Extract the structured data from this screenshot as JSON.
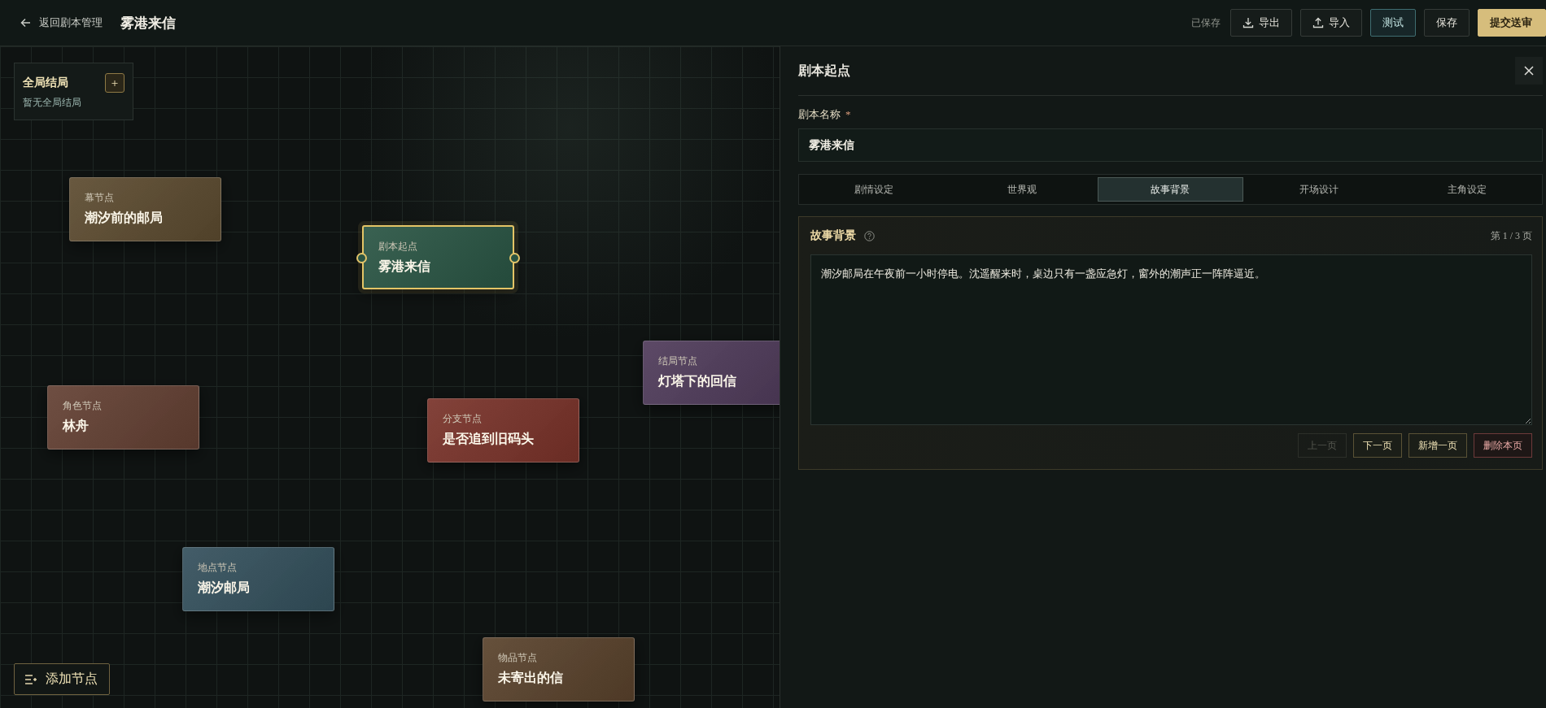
{
  "header": {
    "back_label": "返回剧本管理",
    "title": "雾港来信",
    "save_status": "已保存",
    "buttons": [
      {
        "label": "导出",
        "kind": "export"
      },
      {
        "label": "导入",
        "kind": "import"
      },
      {
        "label": "测试",
        "kind": "accent"
      },
      {
        "label": "保存",
        "kind": "default"
      },
      {
        "label": "提交送审",
        "kind": "primary"
      }
    ]
  },
  "canvas": {
    "global_endings": {
      "title": "全局结局",
      "add_label": "+",
      "empty_text": "暂无全局结局"
    },
    "nodes": [
      {
        "type_label": "幕节点",
        "name": "潮汐前的邮局",
        "color": "#5a4a30",
        "selected": false
      },
      {
        "type_label": "剧本起点",
        "name": "雾港来信",
        "color": "#2a5443",
        "selected": true
      },
      {
        "type_label": "结局节点",
        "name": "灯塔下的回信",
        "color": "#4d3a58",
        "selected": false
      },
      {
        "type_label": "角色节点",
        "name": "林舟",
        "color": "#613f33",
        "selected": false
      },
      {
        "type_label": "分支节点",
        "name": "是否追到旧码头",
        "color": "#76332a",
        "selected": false
      },
      {
        "type_label": "地点节点",
        "name": "潮汐邮局",
        "color": "#344f5a",
        "selected": false
      },
      {
        "type_label": "物品节点",
        "name": "未寄出的信",
        "color": "#57412c",
        "selected": false
      }
    ],
    "add_node_label": "添加节点"
  },
  "panel": {
    "title": "剧本起点",
    "field_label": "剧本名称",
    "required_mark": "*",
    "field_value": "雾港来信",
    "tabs": [
      {
        "label": "剧情设定",
        "selected": false
      },
      {
        "label": "世界观",
        "selected": false
      },
      {
        "label": "故事背景",
        "selected": true
      },
      {
        "label": "开场设计",
        "selected": false
      },
      {
        "label": "主角设定",
        "selected": false
      }
    ],
    "section": {
      "title": "故事背景",
      "page_indicator": "第 1 / 3 页",
      "text": "潮汐邮局在午夜前一小时停电。沈遥醒来时，桌边只有一盏应急灯，窗外的潮声正一阵阵逼近。",
      "buttons": [
        {
          "label": "上一页",
          "kind": "default",
          "disabled": true
        },
        {
          "label": "下一页",
          "kind": "default",
          "disabled": false
        },
        {
          "label": "新增一页",
          "kind": "default",
          "disabled": false
        },
        {
          "label": "删除本页",
          "kind": "danger",
          "disabled": false
        }
      ]
    }
  }
}
